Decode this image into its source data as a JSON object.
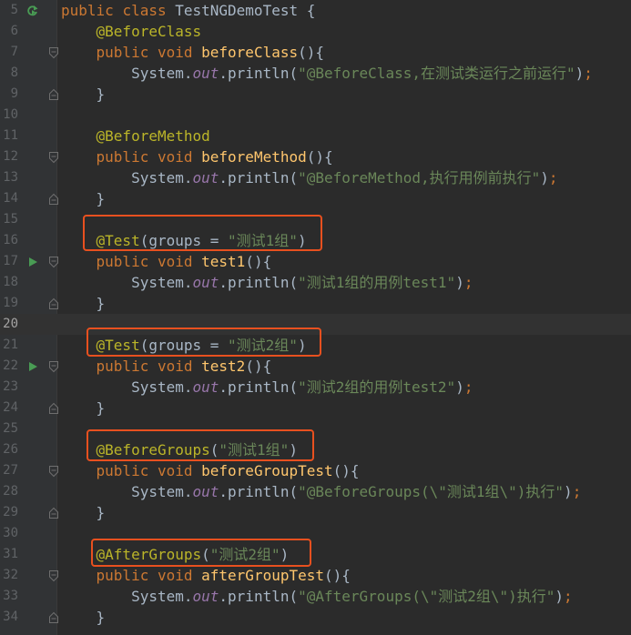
{
  "colors": {
    "background": "#2b2b2b",
    "gutter": "#313335",
    "keyword": "#cc7832",
    "annotation": "#bbb529",
    "method": "#ffc66d",
    "string": "#6a8759",
    "static_field": "#9876aa",
    "highlight_box": "#e8501f"
  },
  "lines": [
    {
      "num": "5",
      "marker": "run-class-icon",
      "tokens": [
        {
          "c": "kw",
          "t": "public "
        },
        {
          "c": "kw",
          "t": "class "
        },
        {
          "c": "plain",
          "t": "TestNGDemoTest {"
        }
      ]
    },
    {
      "num": "6",
      "tokens": [
        {
          "c": "plain",
          "t": "    "
        },
        {
          "c": "anno",
          "t": "@BeforeClass"
        }
      ]
    },
    {
      "num": "7",
      "fold": "open",
      "tokens": [
        {
          "c": "plain",
          "t": "    "
        },
        {
          "c": "kw",
          "t": "public "
        },
        {
          "c": "kw",
          "t": "void "
        },
        {
          "c": "meth",
          "t": "beforeClass"
        },
        {
          "c": "plain",
          "t": "(){"
        }
      ]
    },
    {
      "num": "8",
      "tokens": [
        {
          "c": "plain",
          "t": "        System."
        },
        {
          "c": "fld",
          "t": "out"
        },
        {
          "c": "plain",
          "t": ".println("
        },
        {
          "c": "str",
          "t": "\"@BeforeClass,在测试类运行之前运行\""
        },
        {
          "c": "plain",
          "t": ")"
        },
        {
          "c": "kw",
          "t": ";"
        }
      ]
    },
    {
      "num": "9",
      "fold": "close",
      "tokens": [
        {
          "c": "plain",
          "t": "    }"
        }
      ]
    },
    {
      "num": "10",
      "tokens": []
    },
    {
      "num": "11",
      "tokens": [
        {
          "c": "plain",
          "t": "    "
        },
        {
          "c": "anno",
          "t": "@BeforeMethod"
        }
      ]
    },
    {
      "num": "12",
      "fold": "open",
      "tokens": [
        {
          "c": "plain",
          "t": "    "
        },
        {
          "c": "kw",
          "t": "public "
        },
        {
          "c": "kw",
          "t": "void "
        },
        {
          "c": "meth",
          "t": "beforeMethod"
        },
        {
          "c": "plain",
          "t": "(){"
        }
      ]
    },
    {
      "num": "13",
      "tokens": [
        {
          "c": "plain",
          "t": "        System."
        },
        {
          "c": "fld",
          "t": "out"
        },
        {
          "c": "plain",
          "t": ".println("
        },
        {
          "c": "str",
          "t": "\"@BeforeMethod,执行用例前执行\""
        },
        {
          "c": "plain",
          "t": ")"
        },
        {
          "c": "kw",
          "t": ";"
        }
      ]
    },
    {
      "num": "14",
      "fold": "close",
      "tokens": [
        {
          "c": "plain",
          "t": "    }"
        }
      ]
    },
    {
      "num": "15",
      "tokens": []
    },
    {
      "num": "16",
      "tokens": [
        {
          "c": "plain",
          "t": "    "
        },
        {
          "c": "anno",
          "t": "@Test"
        },
        {
          "c": "plain",
          "t": "(groups = "
        },
        {
          "c": "str",
          "t": "\"测试1组\""
        },
        {
          "c": "plain",
          "t": ")"
        }
      ]
    },
    {
      "num": "17",
      "marker": "run-test-icon",
      "fold": "open",
      "tokens": [
        {
          "c": "plain",
          "t": "    "
        },
        {
          "c": "kw",
          "t": "public "
        },
        {
          "c": "kw",
          "t": "void "
        },
        {
          "c": "meth",
          "t": "test1"
        },
        {
          "c": "plain",
          "t": "(){"
        }
      ]
    },
    {
      "num": "18",
      "tokens": [
        {
          "c": "plain",
          "t": "        System."
        },
        {
          "c": "fld",
          "t": "out"
        },
        {
          "c": "plain",
          "t": ".println("
        },
        {
          "c": "str",
          "t": "\"测试1组的用例test1\""
        },
        {
          "c": "plain",
          "t": ")"
        },
        {
          "c": "kw",
          "t": ";"
        }
      ]
    },
    {
      "num": "19",
      "fold": "close",
      "tokens": [
        {
          "c": "plain",
          "t": "    }"
        }
      ]
    },
    {
      "num": "20",
      "current": true,
      "tokens": []
    },
    {
      "num": "21",
      "tokens": [
        {
          "c": "plain",
          "t": "    "
        },
        {
          "c": "anno",
          "t": "@Test"
        },
        {
          "c": "plain",
          "t": "(groups = "
        },
        {
          "c": "str",
          "t": "\"测试2组\""
        },
        {
          "c": "plain",
          "t": ")"
        }
      ]
    },
    {
      "num": "22",
      "marker": "run-test-icon",
      "fold": "open",
      "tokens": [
        {
          "c": "plain",
          "t": "    "
        },
        {
          "c": "kw",
          "t": "public "
        },
        {
          "c": "kw",
          "t": "void "
        },
        {
          "c": "meth",
          "t": "test2"
        },
        {
          "c": "plain",
          "t": "(){"
        }
      ]
    },
    {
      "num": "23",
      "tokens": [
        {
          "c": "plain",
          "t": "        System."
        },
        {
          "c": "fld",
          "t": "out"
        },
        {
          "c": "plain",
          "t": ".println("
        },
        {
          "c": "str",
          "t": "\"测试2组的用例test2\""
        },
        {
          "c": "plain",
          "t": ")"
        },
        {
          "c": "kw",
          "t": ";"
        }
      ]
    },
    {
      "num": "24",
      "fold": "close",
      "tokens": [
        {
          "c": "plain",
          "t": "    }"
        }
      ]
    },
    {
      "num": "25",
      "tokens": []
    },
    {
      "num": "26",
      "tokens": [
        {
          "c": "plain",
          "t": "    "
        },
        {
          "c": "anno",
          "t": "@BeforeGroups"
        },
        {
          "c": "plain",
          "t": "("
        },
        {
          "c": "str",
          "t": "\"测试1组\""
        },
        {
          "c": "plain",
          "t": ")"
        }
      ]
    },
    {
      "num": "27",
      "fold": "open",
      "tokens": [
        {
          "c": "plain",
          "t": "    "
        },
        {
          "c": "kw",
          "t": "public "
        },
        {
          "c": "kw",
          "t": "void "
        },
        {
          "c": "meth",
          "t": "beforeGroupTest"
        },
        {
          "c": "plain",
          "t": "(){"
        }
      ]
    },
    {
      "num": "28",
      "tokens": [
        {
          "c": "plain",
          "t": "        System."
        },
        {
          "c": "fld",
          "t": "out"
        },
        {
          "c": "plain",
          "t": ".println("
        },
        {
          "c": "str",
          "t": "\"@BeforeGroups(\\\"测试1组\\\")执行\""
        },
        {
          "c": "plain",
          "t": ")"
        },
        {
          "c": "kw",
          "t": ";"
        }
      ]
    },
    {
      "num": "29",
      "fold": "close",
      "tokens": [
        {
          "c": "plain",
          "t": "    }"
        }
      ]
    },
    {
      "num": "30",
      "tokens": []
    },
    {
      "num": "31",
      "tokens": [
        {
          "c": "plain",
          "t": "    "
        },
        {
          "c": "anno",
          "t": "@AfterGroups"
        },
        {
          "c": "plain",
          "t": "("
        },
        {
          "c": "str",
          "t": "\"测试2组\""
        },
        {
          "c": "plain",
          "t": ")"
        }
      ]
    },
    {
      "num": "32",
      "fold": "open",
      "tokens": [
        {
          "c": "plain",
          "t": "    "
        },
        {
          "c": "kw",
          "t": "public "
        },
        {
          "c": "kw",
          "t": "void "
        },
        {
          "c": "meth",
          "t": "afterGroupTest"
        },
        {
          "c": "plain",
          "t": "(){"
        }
      ]
    },
    {
      "num": "33",
      "tokens": [
        {
          "c": "plain",
          "t": "        System."
        },
        {
          "c": "fld",
          "t": "out"
        },
        {
          "c": "plain",
          "t": ".println("
        },
        {
          "c": "str",
          "t": "\"@AfterGroups(\\\"测试2组\\\")执行\""
        },
        {
          "c": "plain",
          "t": ")"
        },
        {
          "c": "kw",
          "t": ";"
        }
      ]
    },
    {
      "num": "34",
      "fold": "close",
      "tokens": [
        {
          "c": "plain",
          "t": "    }"
        }
      ]
    }
  ]
}
